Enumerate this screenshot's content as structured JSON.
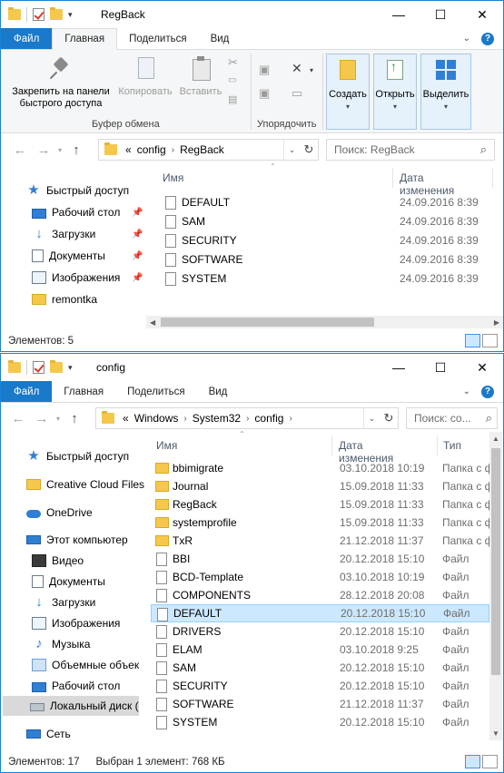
{
  "window1": {
    "title": "RegBack",
    "controls": {
      "minimize": "—",
      "maximize": "☐",
      "close": "✕"
    },
    "tabs": [
      "Файл",
      "Главная",
      "Поделиться",
      "Вид"
    ],
    "tab_expand": "⌄",
    "help": "?",
    "ribbon": {
      "pin": "Закрепить на панели быстрого доступа",
      "copy": "Копировать",
      "paste": "Вставить",
      "clipboard_group": "Буфер обмена",
      "organize_group": "Упорядочить",
      "create": "Создать",
      "open": "Открыть",
      "select": "Выделить"
    },
    "address": {
      "prefix": "«",
      "crumbs": [
        "config",
        "RegBack"
      ],
      "search_placeholder": "Поиск: RegBack"
    },
    "nav": [
      {
        "label": "Быстрый доступ",
        "icon": "star-icon"
      },
      {
        "label": "Рабочий стол",
        "icon": "desktop-icon",
        "pinned": true
      },
      {
        "label": "Загрузки",
        "icon": "download-icon",
        "pinned": true
      },
      {
        "label": "Документы",
        "icon": "documents-icon",
        "pinned": true
      },
      {
        "label": "Изображения",
        "icon": "pictures-icon",
        "pinned": true
      },
      {
        "label": "remontka",
        "icon": "folder-icon"
      }
    ],
    "columns": {
      "name": "Имя",
      "date": "Дата изменения"
    },
    "files": [
      {
        "name": "DEFAULT",
        "date": "24.09.2016 8:39"
      },
      {
        "name": "SAM",
        "date": "24.09.2016 8:39"
      },
      {
        "name": "SECURITY",
        "date": "24.09.2016 8:39"
      },
      {
        "name": "SOFTWARE",
        "date": "24.09.2016 8:39"
      },
      {
        "name": "SYSTEM",
        "date": "24.09.2016 8:39"
      }
    ],
    "status": "Элементов: 5"
  },
  "window2": {
    "title": "config",
    "controls": {
      "minimize": "—",
      "maximize": "☐",
      "close": "✕"
    },
    "tabs": [
      "Файл",
      "Главная",
      "Поделиться",
      "Вид"
    ],
    "tab_expand": "⌄",
    "help": "?",
    "address": {
      "prefix": "«",
      "crumbs": [
        "Windows",
        "System32",
        "config"
      ],
      "search_placeholder": "Поиск: co..."
    },
    "nav": [
      {
        "label": "Быстрый доступ",
        "icon": "star-icon"
      },
      {
        "label": "Creative Cloud Files",
        "icon": "creative-cloud-icon"
      },
      {
        "label": "OneDrive",
        "icon": "onedrive-icon"
      },
      {
        "label": "Этот компьютер",
        "icon": "computer-icon"
      },
      {
        "label": "Видео",
        "icon": "video-icon"
      },
      {
        "label": "Документы",
        "icon": "documents-icon"
      },
      {
        "label": "Загрузки",
        "icon": "download-icon"
      },
      {
        "label": "Изображения",
        "icon": "pictures-icon"
      },
      {
        "label": "Музыка",
        "icon": "music-icon"
      },
      {
        "label": "Объемные объекты",
        "icon": "3d-objects-icon"
      },
      {
        "label": "Рабочий стол",
        "icon": "desktop-icon"
      },
      {
        "label": "Локальный диск (C:)",
        "icon": "disk-icon",
        "selected": true
      },
      {
        "label": "Сеть",
        "icon": "network-icon"
      }
    ],
    "columns": {
      "name": "Имя",
      "date": "Дата изменения",
      "type": "Тип"
    },
    "files": [
      {
        "name": "bbimigrate",
        "date": "03.10.2018 10:19",
        "type": "Папка с файлами",
        "kind": "folder"
      },
      {
        "name": "Journal",
        "date": "15.09.2018 11:33",
        "type": "Папка с файлами",
        "kind": "folder"
      },
      {
        "name": "RegBack",
        "date": "15.09.2018 11:33",
        "type": "Папка с файлами",
        "kind": "folder"
      },
      {
        "name": "systemprofile",
        "date": "15.09.2018 11:33",
        "type": "Папка с файлами",
        "kind": "folder"
      },
      {
        "name": "TxR",
        "date": "21.12.2018 11:37",
        "type": "Папка с файлами",
        "kind": "folder"
      },
      {
        "name": "BBI",
        "date": "20.12.2018 15:10",
        "type": "Файл",
        "kind": "file"
      },
      {
        "name": "BCD-Template",
        "date": "03.10.2018 10:19",
        "type": "Файл",
        "kind": "file"
      },
      {
        "name": "COMPONENTS",
        "date": "28.12.2018 20:08",
        "type": "Файл",
        "kind": "file"
      },
      {
        "name": "DEFAULT",
        "date": "20.12.2018 15:10",
        "type": "Файл",
        "kind": "file",
        "selected": true
      },
      {
        "name": "DRIVERS",
        "date": "20.12.2018 15:10",
        "type": "Файл",
        "kind": "file"
      },
      {
        "name": "ELAM",
        "date": "03.10.2018 9:25",
        "type": "Файл",
        "kind": "file"
      },
      {
        "name": "SAM",
        "date": "20.12.2018 15:10",
        "type": "Файл",
        "kind": "file"
      },
      {
        "name": "SECURITY",
        "date": "20.12.2018 15:10",
        "type": "Файл",
        "kind": "file"
      },
      {
        "name": "SOFTWARE",
        "date": "21.12.2018 11:37",
        "type": "Файл",
        "kind": "file"
      },
      {
        "name": "SYSTEM",
        "date": "20.12.2018 15:10",
        "type": "Файл",
        "kind": "file"
      }
    ],
    "status": {
      "count": "Элементов: 17",
      "selection": "Выбран 1 элемент: 768 КБ"
    }
  },
  "colors": {
    "accent": "#1979ca",
    "selection": "#cce8ff",
    "folder": "#f5c84c"
  }
}
